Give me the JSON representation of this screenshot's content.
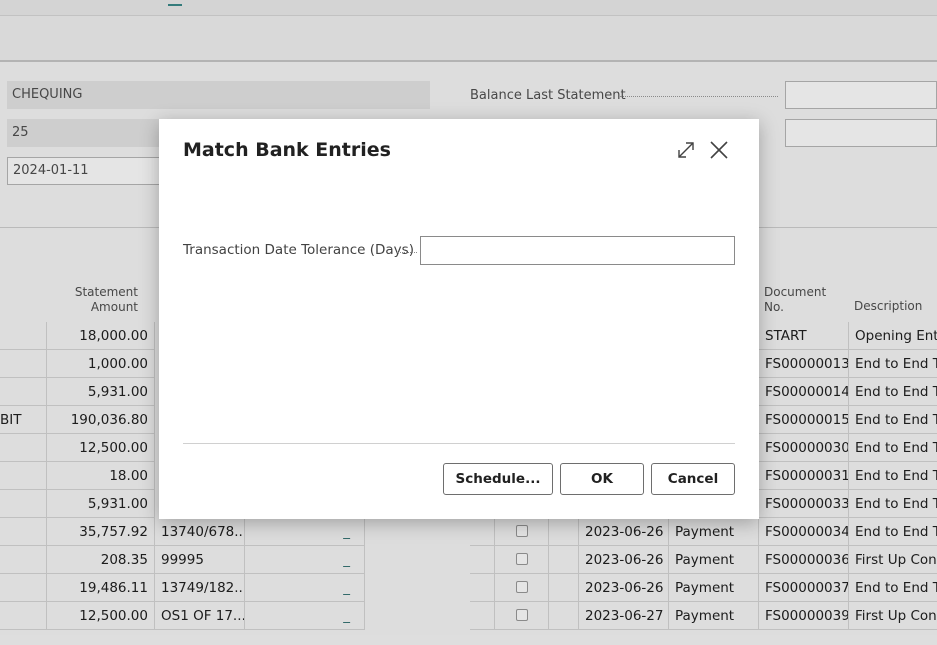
{
  "header": {
    "fields": {
      "bank_account": "CHEQUING",
      "statement_no": "25",
      "statement_date": "2024-01-11"
    },
    "balance_last_statement_label": "Balance Last Statement"
  },
  "left_columns": {
    "statement_amount": "Statement Amount"
  },
  "right_columns": {
    "document_no": "Document No.",
    "description": "Description"
  },
  "rows": [
    {
      "desc_left": "",
      "amount": "18,000.00",
      "ref": "",
      "dash": "",
      "date": "",
      "type": "",
      "doc": "START",
      "desc": "Opening Entr"
    },
    {
      "desc_left": "",
      "amount": "1,000.00",
      "ref": "",
      "dash": "",
      "date": "",
      "type": "",
      "doc": "FS00000013",
      "desc": "End to End Te"
    },
    {
      "desc_left": "",
      "amount": "5,931.00",
      "ref": "",
      "dash": "",
      "date": "",
      "type": "",
      "doc": "FS00000014",
      "desc": "End to End Te"
    },
    {
      "desc_left": "BIT",
      "amount": "190,036.80",
      "ref": "",
      "dash": "",
      "date": "",
      "type": "",
      "doc": "FS00000015",
      "desc": "End to End Te"
    },
    {
      "desc_left": "",
      "amount": "12,500.00",
      "ref": "",
      "dash": "",
      "date": "",
      "type": "",
      "doc": "FS00000030",
      "desc": "End to End Te"
    },
    {
      "desc_left": "",
      "amount": "18.00",
      "ref": "",
      "dash": "",
      "date": "",
      "type": "",
      "doc": "FS00000031",
      "desc": "End to End Te"
    },
    {
      "desc_left": "",
      "amount": "5,931.00",
      "ref": "",
      "dash": "",
      "date": "",
      "type": "",
      "doc": "FS00000033",
      "desc": "End to End Te"
    },
    {
      "desc_left": "",
      "amount": "35,757.92",
      "ref": "13740/678...",
      "dash": "_",
      "date": "2023-06-26",
      "type": "Payment",
      "doc": "FS00000034",
      "desc": "End to End Te"
    },
    {
      "desc_left": "",
      "amount": "208.35",
      "ref": "99995",
      "dash": "_",
      "date": "2023-06-26",
      "type": "Payment",
      "doc": "FS00000036",
      "desc": "First Up Cons"
    },
    {
      "desc_left": "",
      "amount": "19,486.11",
      "ref": "13749/182...",
      "dash": "_",
      "date": "2023-06-26",
      "type": "Payment",
      "doc": "FS00000037",
      "desc": "End to End Te"
    },
    {
      "desc_left": "",
      "amount": "12,500.00",
      "ref": "OS1 OF 17...",
      "dash": "_",
      "date": "2023-06-27",
      "type": "Payment",
      "doc": "FS00000039",
      "desc": "First Up Cons"
    }
  ],
  "dialog": {
    "title": "Match Bank Entries",
    "field_label": "Transaction Date Tolerance (Days)",
    "field_value": "",
    "buttons": {
      "schedule": "Schedule...",
      "ok": "OK",
      "cancel": "Cancel"
    },
    "icons": [
      "expand-icon",
      "close-icon"
    ]
  }
}
